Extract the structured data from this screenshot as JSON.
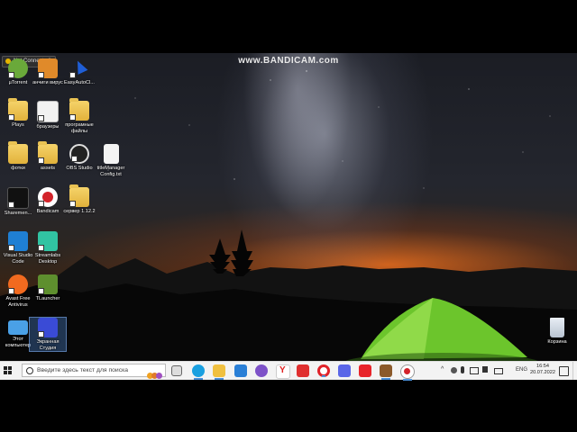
{
  "overlay": {
    "watermark": "www.BANDICAM.com",
    "connection_status": "Not Connected!"
  },
  "desktop_icons": [
    {
      "label": "µTorrent"
    },
    {
      "label": "анчиги вирус"
    },
    {
      "label": "EasyAutoCl..."
    },
    {
      "label": "Plays"
    },
    {
      "label": "браузеры"
    },
    {
      "label": "програмные файлы"
    },
    {
      "label": "фотки"
    },
    {
      "label": "assets"
    },
    {
      "label": "OBS Studio"
    },
    {
      "label": "titleManager Config.txt"
    },
    {
      "label": "Sharemen..."
    },
    {
      "label": "Bandicam"
    },
    {
      "label": "сервер 1.12.2"
    },
    {
      "label": "Visual Studio Code"
    },
    {
      "label": "Streamlabs Desktop"
    },
    {
      "label": "Avast Free Antivirus"
    },
    {
      "label": "TLauncher"
    },
    {
      "label": "Этот компьютер"
    },
    {
      "label": "Экранная Студия"
    },
    {
      "label": "Корзина"
    }
  ],
  "taskbar": {
    "search_placeholder": "Введите здесь текст для поиска",
    "language": "ENG",
    "time": "16:54",
    "date": "20.07.2022"
  },
  "colors": {
    "taskbar_bg": "#f3f3f3",
    "horizon_glow": "#eb6e1e",
    "tent_green": "#7bd33a"
  }
}
